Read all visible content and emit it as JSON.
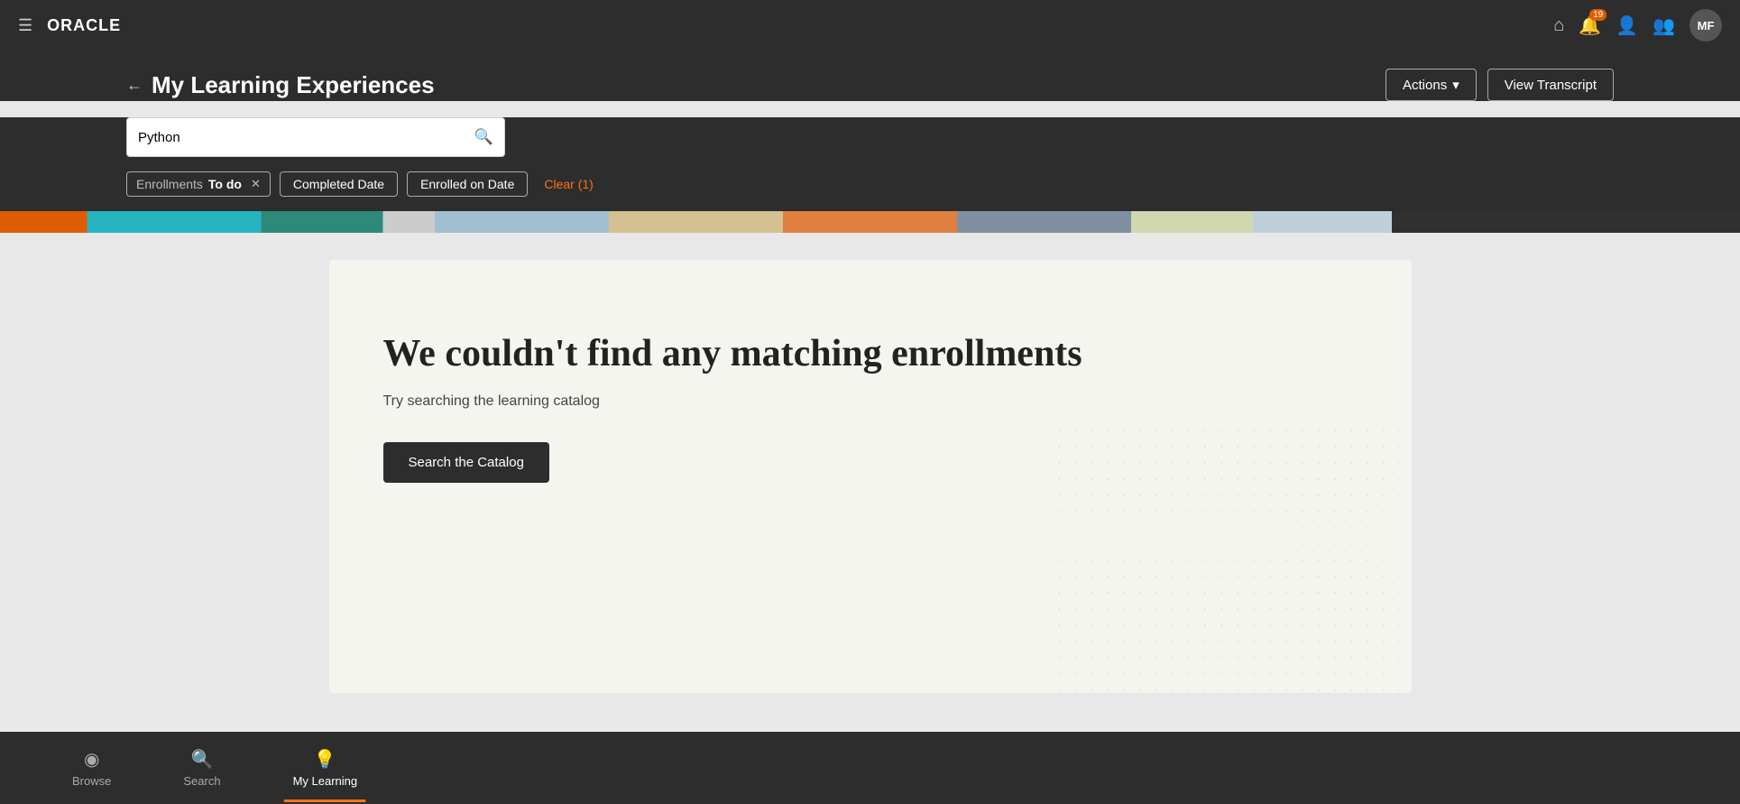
{
  "topNav": {
    "logoText": "ORACLE",
    "notificationCount": "19",
    "avatarInitials": "MF"
  },
  "pageHeader": {
    "backLabel": "←",
    "title": "My Learning Experiences",
    "actionsLabel": "Actions",
    "viewTranscriptLabel": "View Transcript"
  },
  "searchBar": {
    "value": "Python",
    "placeholder": "Search..."
  },
  "filters": {
    "chip": {
      "label": "Enrollments",
      "value": "To do"
    },
    "completedDateLabel": "Completed Date",
    "enrolledOnDateLabel": "Enrolled on Date",
    "clearLabel": "Clear (1)"
  },
  "emptyState": {
    "title": "We couldn't find any matching enrollments",
    "subtitle": "Try searching the learning catalog",
    "searchCatalogLabel": "Search the Catalog"
  },
  "bottomNav": {
    "browseLabel": "Browse",
    "searchLabel": "Search",
    "myLearningLabel": "My Learning"
  }
}
